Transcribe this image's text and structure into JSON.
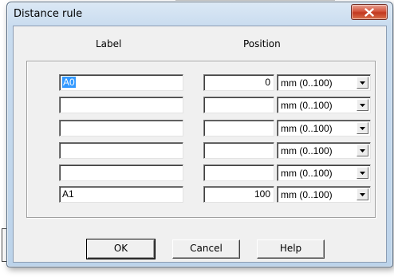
{
  "dialog": {
    "title": "Distance rule"
  },
  "columns": {
    "label": "Label",
    "position": "Position"
  },
  "rows": [
    {
      "label": "A0",
      "position": "0",
      "unit": "mm  (0..100)"
    },
    {
      "label": "",
      "position": "",
      "unit": "mm  (0..100)"
    },
    {
      "label": "",
      "position": "",
      "unit": "mm  (0..100)"
    },
    {
      "label": "",
      "position": "",
      "unit": "mm  (0..100)"
    },
    {
      "label": "",
      "position": "",
      "unit": "mm  (0..100)"
    },
    {
      "label": "A1",
      "position": "100",
      "unit": "mm  (0..100)"
    }
  ],
  "buttons": {
    "ok": "OK",
    "cancel": "Cancel",
    "help": "Help"
  },
  "colors": {
    "selection": "#3399ff",
    "close_button": "#c2381f",
    "frame": "#c9dcef"
  },
  "icons": {
    "close": "close-x-icon",
    "dropdown": "chevron-down-icon"
  }
}
